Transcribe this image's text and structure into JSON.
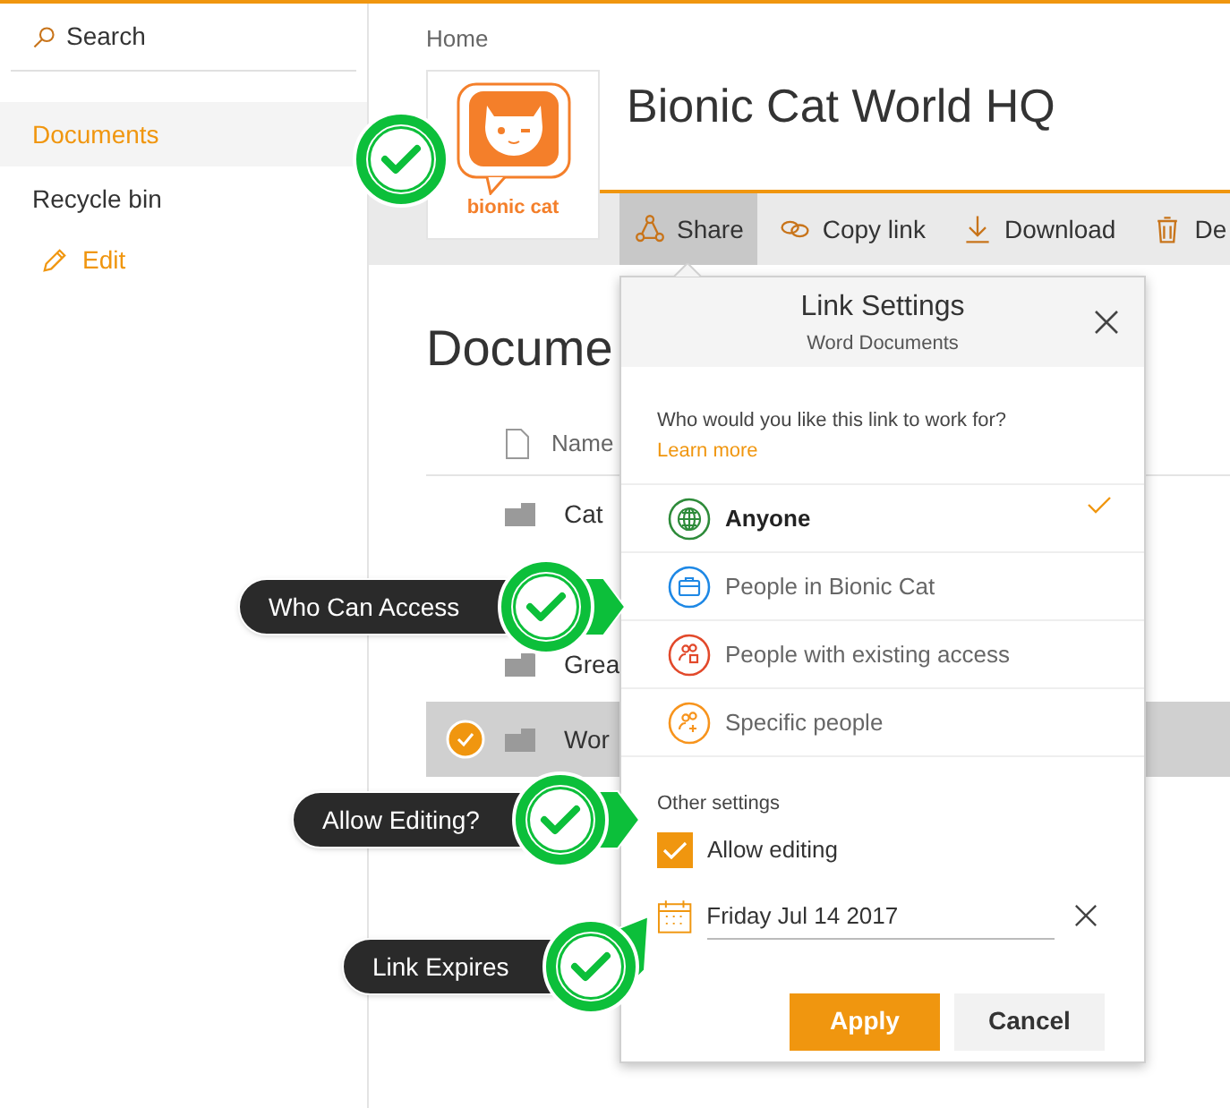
{
  "sidebar": {
    "search": {
      "placeholder": "Search"
    },
    "items": [
      {
        "label": "Documents",
        "selected": true
      },
      {
        "label": "Recycle bin",
        "selected": false
      }
    ],
    "edit_link": "Edit"
  },
  "breadcrumb": "Home",
  "site_title": "Bionic Cat World HQ",
  "logo_text": "bionic cat",
  "commands": [
    {
      "label": "Share",
      "kind": "share",
      "selected": true
    },
    {
      "label": "Copy link",
      "kind": "link",
      "selected": false
    },
    {
      "label": "Download",
      "kind": "download",
      "selected": false
    },
    {
      "label": "De",
      "kind": "delete",
      "selected": false
    }
  ],
  "library": {
    "title": "Docume",
    "column": "Name",
    "rows": [
      {
        "name": "Cat",
        "selected": false
      },
      {
        "selected": false
      },
      {
        "name": "Grea",
        "selected": false
      },
      {
        "name": "Wor",
        "selected": true
      }
    ]
  },
  "link_settings": {
    "title": "Link Settings",
    "subtitle": "Word Documents",
    "prompt": "Who would you like this link to work for?",
    "learn_more": "Learn more",
    "options": [
      {
        "label": "Anyone",
        "kind": "globe",
        "color": "#2e8b3a",
        "selected": true
      },
      {
        "label": "People in Bionic Cat",
        "kind": "org",
        "color": "#1e88e5",
        "selected": false
      },
      {
        "label": "People with existing access",
        "kind": "existing",
        "color": "#e2492b",
        "selected": false
      },
      {
        "label": "Specific people",
        "kind": "specific",
        "color": "#f7941d",
        "selected": false
      }
    ],
    "other_settings": "Other settings",
    "allow_editing": {
      "label": "Allow editing",
      "checked": true
    },
    "expiry": {
      "value": "Friday Jul 14 2017"
    },
    "buttons": [
      "Apply",
      "Cancel"
    ]
  },
  "callouts": [
    {
      "text": "Who Can Access"
    },
    {
      "text": "Allow Editing?"
    },
    {
      "text": "Link Expires"
    }
  ]
}
